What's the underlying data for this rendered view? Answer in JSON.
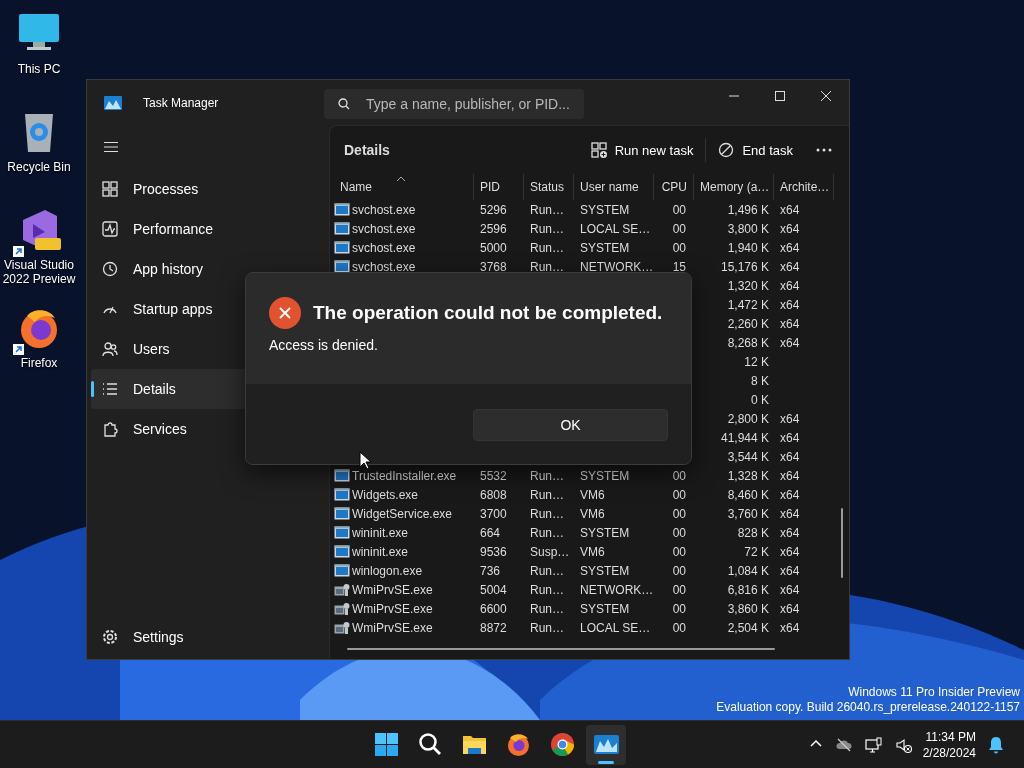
{
  "desktop": {
    "icons": [
      {
        "label": "This PC",
        "kind": "pc"
      },
      {
        "label": "Recycle Bin",
        "kind": "bin"
      },
      {
        "label": "Visual Studio 2022 Preview",
        "kind": "vs",
        "shortcut": true
      },
      {
        "label": "Firefox",
        "kind": "firefox",
        "shortcut": true
      }
    ],
    "watermark": [
      "Windows 11 Pro Insider Preview",
      "Evaluation copy. Build 26040.rs_prerelease.240122-1157"
    ]
  },
  "window": {
    "title": "Task Manager",
    "search": {
      "placeholder": "Type a name, publisher, or PID..."
    }
  },
  "sidebar": {
    "items": [
      {
        "label": "Processes",
        "kind": "processes",
        "selected": false
      },
      {
        "label": "Performance",
        "kind": "performance",
        "selected": false
      },
      {
        "label": "App history",
        "kind": "history",
        "selected": false
      },
      {
        "label": "Startup apps",
        "kind": "startup",
        "selected": false
      },
      {
        "label": "Users",
        "kind": "users",
        "selected": false
      },
      {
        "label": "Details",
        "kind": "details",
        "selected": true
      },
      {
        "label": "Services",
        "kind": "services",
        "selected": false
      }
    ],
    "footer": {
      "label": "Settings",
      "kind": "settings",
      "selected": false
    }
  },
  "page": {
    "title": "Details",
    "actions": [
      {
        "label": "Run new task",
        "kind": "run"
      },
      {
        "label": "End task",
        "kind": "end"
      }
    ]
  },
  "table": {
    "columns": [
      {
        "label": "Name",
        "sorted": true
      },
      {
        "label": "PID"
      },
      {
        "label": "Status"
      },
      {
        "label": "User name"
      },
      {
        "label": "CPU"
      },
      {
        "label": "Memory (a…"
      },
      {
        "label": "Archite…"
      }
    ],
    "rows": [
      {
        "kind": "app",
        "name": "svchost.exe",
        "pid": "5296",
        "status": "Run…",
        "user": "SYSTEM",
        "cpu": "00",
        "memory": "1,496 K",
        "arch": "x64"
      },
      {
        "kind": "app",
        "name": "svchost.exe",
        "pid": "2596",
        "status": "Run…",
        "user": "LOCAL SE…",
        "cpu": "00",
        "memory": "3,800 K",
        "arch": "x64"
      },
      {
        "kind": "app",
        "name": "svchost.exe",
        "pid": "5000",
        "status": "Run…",
        "user": "SYSTEM",
        "cpu": "00",
        "memory": "1,940 K",
        "arch": "x64"
      },
      {
        "kind": "app",
        "name": "svchost.exe",
        "pid": "3768",
        "status": "Run…",
        "user": "NETWORK…",
        "cpu": "15",
        "memory": "15,176 K",
        "arch": "x64"
      },
      {
        "memory": "1,320 K",
        "arch": "x64"
      },
      {
        "memory": "1,472 K",
        "arch": "x64"
      },
      {
        "memory": "2,260 K",
        "arch": "x64"
      },
      {
        "memory": "8,268 K",
        "arch": "x64"
      },
      {
        "memory": "12 K"
      },
      {
        "memory": "8 K"
      },
      {
        "memory": "0 K"
      },
      {
        "memory": "2,800 K",
        "arch": "x64"
      },
      {
        "memory": "41,944 K",
        "arch": "x64"
      },
      {
        "memory": "3,544 K",
        "arch": "x64"
      },
      {
        "kind": "app",
        "name": "TrustedInstaller.exe",
        "pid": "5532",
        "status": "Run…",
        "user": "SYSTEM",
        "cpu": "00",
        "memory": "1,328 K",
        "arch": "x64"
      },
      {
        "kind": "app",
        "name": "Widgets.exe",
        "pid": "6808",
        "status": "Run…",
        "user": "VM6",
        "cpu": "00",
        "memory": "8,460 K",
        "arch": "x64"
      },
      {
        "kind": "app",
        "name": "WidgetService.exe",
        "pid": "3700",
        "status": "Run…",
        "user": "VM6",
        "cpu": "00",
        "memory": "3,760 K",
        "arch": "x64"
      },
      {
        "kind": "app",
        "name": "wininit.exe",
        "pid": "664",
        "status": "Run…",
        "user": "SYSTEM",
        "cpu": "00",
        "memory": "828 K",
        "arch": "x64"
      },
      {
        "kind": "app",
        "name": "wininit.exe",
        "pid": "9536",
        "status": "Susp…",
        "user": "VM6",
        "cpu": "00",
        "memory": "72 K",
        "arch": "x64"
      },
      {
        "kind": "app",
        "name": "winlogon.exe",
        "pid": "736",
        "status": "Run…",
        "user": "SYSTEM",
        "cpu": "00",
        "memory": "1,084 K",
        "arch": "x64"
      },
      {
        "kind": "wmi",
        "name": "WmiPrvSE.exe",
        "pid": "5004",
        "status": "Run…",
        "user": "NETWORK…",
        "cpu": "00",
        "memory": "6,816 K",
        "arch": "x64"
      },
      {
        "kind": "wmi",
        "name": "WmiPrvSE.exe",
        "pid": "6600",
        "status": "Run…",
        "user": "SYSTEM",
        "cpu": "00",
        "memory": "3,860 K",
        "arch": "x64"
      },
      {
        "kind": "wmi",
        "name": "WmiPrvSE.exe",
        "pid": "8872",
        "status": "Run…",
        "user": "LOCAL SE…",
        "cpu": "00",
        "memory": "2,504 K",
        "arch": "x64"
      }
    ]
  },
  "dialog": {
    "title": "The operation could not be completed.",
    "message": "Access is denied.",
    "button": "OK"
  },
  "taskbar": {
    "apps": [
      {
        "kind": "start",
        "active": false
      },
      {
        "kind": "search",
        "active": false
      },
      {
        "kind": "explorer",
        "active": false
      },
      {
        "kind": "firefox",
        "active": false
      },
      {
        "kind": "chrome",
        "active": false
      },
      {
        "kind": "taskmgr",
        "active": true
      }
    ],
    "tray": [
      {
        "kind": "chevron"
      },
      {
        "kind": "cloud"
      },
      {
        "kind": "network"
      },
      {
        "kind": "volume"
      }
    ],
    "time": "11:34 PM",
    "date": "2/28/2024"
  }
}
